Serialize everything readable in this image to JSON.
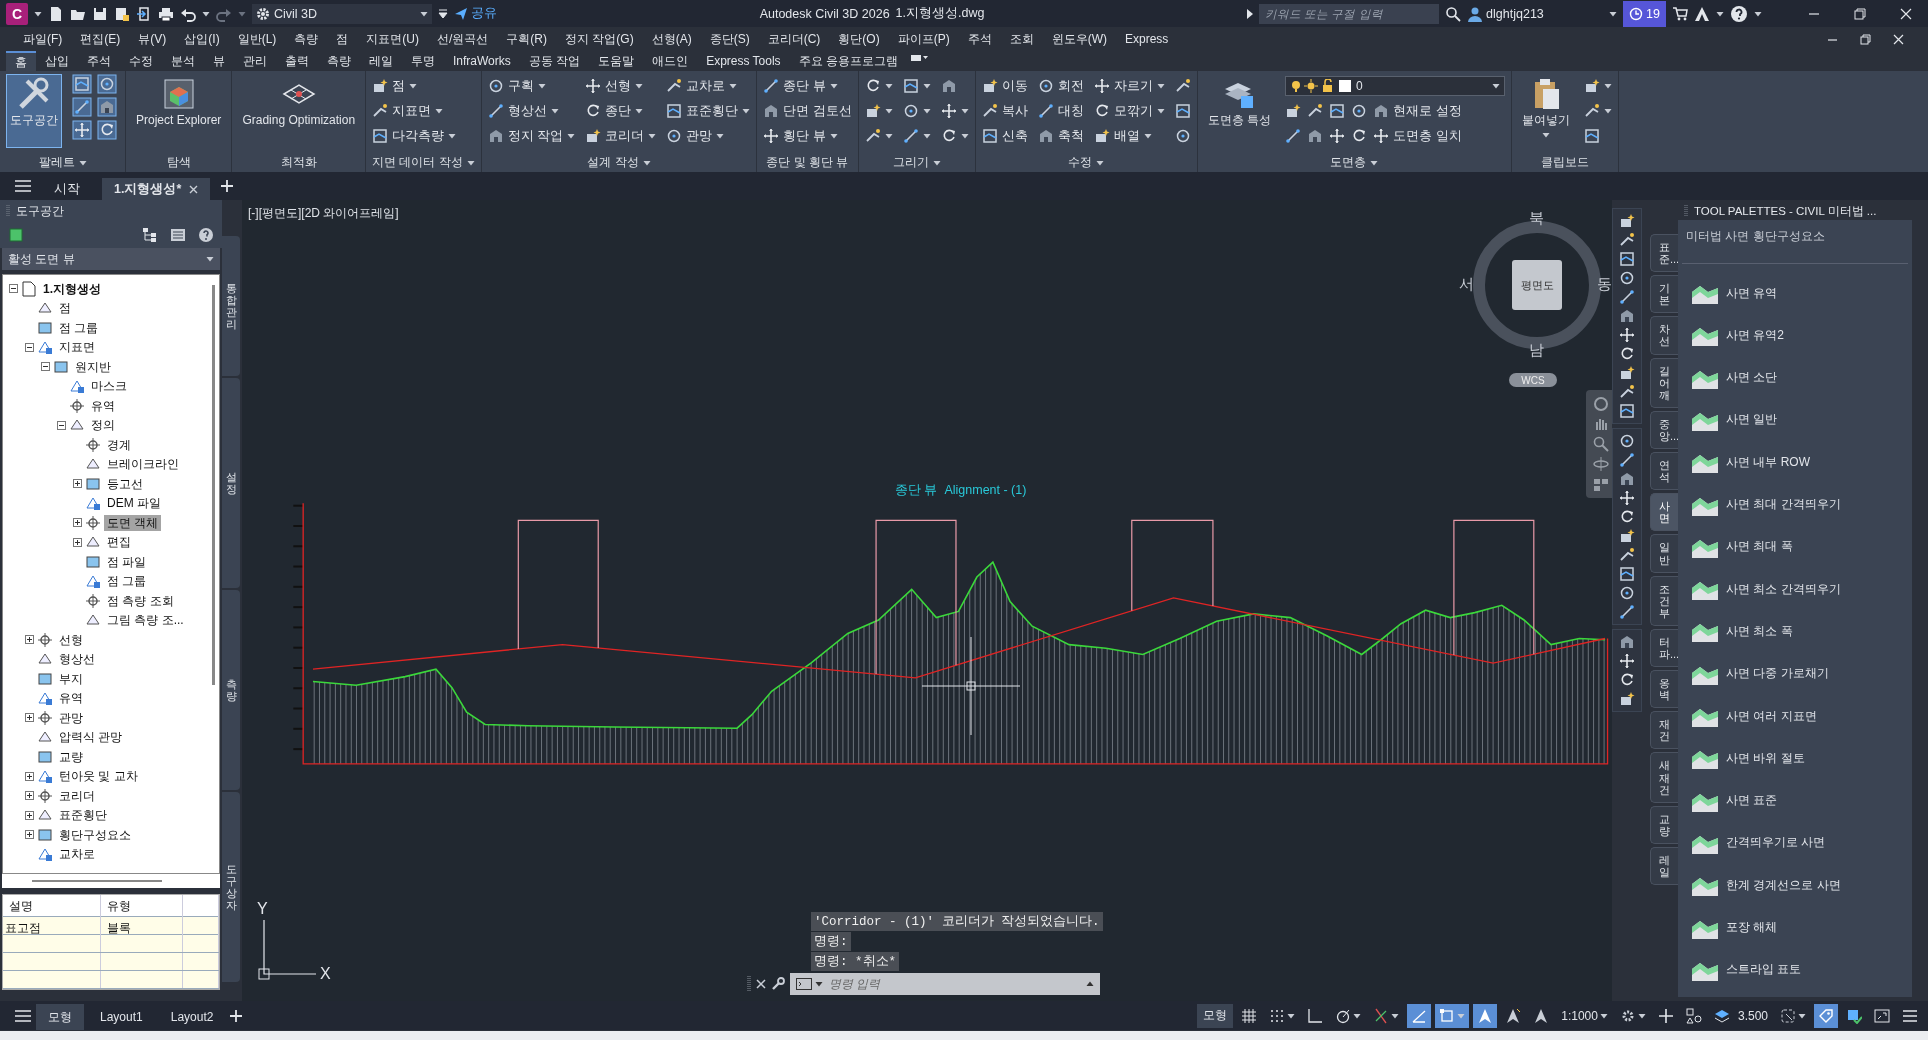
{
  "title_bar": {
    "app_logo": "C",
    "workspace": "Civil 3D",
    "share": "공유",
    "app_name": "Autodesk Civil 3D 2026",
    "file_name": "1.지형생성.dwg",
    "search": {
      "placeholder": "키워드 또는 구절 입력"
    },
    "user": "dlghtjq213",
    "badge": "19"
  },
  "menu_bar": [
    "파일(F)",
    "편집(E)",
    "뷰(V)",
    "삽입(I)",
    "일반(L)",
    "측량",
    "점",
    "지표면(U)",
    "선/원곡선",
    "구획(R)",
    "정지 작업(G)",
    "선형(A)",
    "종단(S)",
    "코리더(C)",
    "횡단(O)",
    "파이프(P)",
    "주석",
    "조회",
    "윈도우(W)",
    "Express"
  ],
  "ribbon_tabs": [
    {
      "label": "홈",
      "selected": true
    },
    {
      "label": "삽입",
      "selected": false
    },
    {
      "label": "주석",
      "selected": false
    },
    {
      "label": "수정",
      "selected": false
    },
    {
      "label": "분석",
      "selected": false
    },
    {
      "label": "뷰",
      "selected": false
    },
    {
      "label": "관리",
      "selected": false
    },
    {
      "label": "출력",
      "selected": false
    },
    {
      "label": "측량",
      "selected": false
    },
    {
      "label": "레일",
      "selected": false
    },
    {
      "label": "투명",
      "selected": false
    },
    {
      "label": "InfraWorks",
      "selected": false
    },
    {
      "label": "공동 작업",
      "selected": false
    },
    {
      "label": "도움말",
      "selected": false
    },
    {
      "label": "애드인",
      "selected": false
    },
    {
      "label": "Express Tools",
      "selected": false
    },
    {
      "label": "주요 응용프로그램",
      "selected": false
    }
  ],
  "ribbon_panels": [
    {
      "title": "팔레트",
      "menu": true,
      "kind": "palettes",
      "big": {
        "label": "도구공간",
        "active": true
      }
    },
    {
      "title": "탐색",
      "menu": false,
      "kind": "big",
      "big": {
        "label": "Project Explorer",
        "active": false
      }
    },
    {
      "title": "최적화",
      "menu": false,
      "kind": "big",
      "big": {
        "label": "Grading Optimization",
        "active": false
      }
    },
    {
      "title": "지면 데이터 작성",
      "menu": true,
      "kind": "columns",
      "columns": [
        [
          {
            "label": "점",
            "dropdown": true
          },
          {
            "label": "지표면",
            "dropdown": true
          },
          {
            "label": "다각측량",
            "dropdown": true
          }
        ]
      ]
    },
    {
      "title": "설계 작성",
      "menu": true,
      "kind": "columns",
      "columns": [
        [
          {
            "label": "구획",
            "dropdown": true
          },
          {
            "label": "형상선",
            "dropdown": true
          },
          {
            "label": "정지 작업",
            "dropdown": true
          }
        ],
        [
          {
            "label": "선형",
            "dropdown": true
          },
          {
            "label": "종단",
            "dropdown": true
          },
          {
            "label": "코리더",
            "dropdown": true
          }
        ],
        [
          {
            "label": "교차로",
            "dropdown": true
          },
          {
            "label": "표준횡단",
            "dropdown": true
          },
          {
            "label": "관망",
            "dropdown": true
          }
        ]
      ]
    },
    {
      "title": "종단 및 횡단 뷰",
      "menu": false,
      "kind": "columns",
      "columns": [
        [
          {
            "label": "종단 뷰",
            "dropdown": true
          },
          {
            "label": "단면 검토선",
            "dropdown": false
          },
          {
            "label": "횡단 뷰",
            "dropdown": true
          }
        ]
      ]
    },
    {
      "title": "그리기",
      "menu": true,
      "kind": "columns",
      "columns": [
        [
          {
            "dropdown": true
          },
          {
            "dropdown": true
          },
          {
            "dropdown": true
          }
        ],
        [
          {
            "dropdown": true
          },
          {
            "dropdown": true
          },
          {
            "dropdown": true
          }
        ],
        [
          {
            "dropdown": false
          },
          {
            "dropdown": true
          },
          {
            "dropdown": true
          }
        ]
      ]
    },
    {
      "title": "수정",
      "menu": true,
      "kind": "columns",
      "columns": [
        [
          {
            "label": "이동",
            "dropdown": false
          },
          {
            "label": "복사",
            "dropdown": false
          },
          {
            "label": "신축",
            "dropdown": false
          }
        ],
        [
          {
            "label": "회전",
            "dropdown": false
          },
          {
            "label": "대칭",
            "dropdown": false
          },
          {
            "label": "축척",
            "dropdown": false
          }
        ],
        [
          {
            "label": "자르기",
            "dropdown": true
          },
          {
            "label": "모깎기",
            "dropdown": true
          },
          {
            "label": "배열",
            "dropdown": true
          }
        ],
        [
          {
            "dropdown": false
          },
          {
            "dropdown": false
          },
          {
            "dropdown": false
          }
        ]
      ]
    },
    {
      "title": "도면층",
      "menu": true,
      "kind": "layers",
      "big": {
        "label": "도면층 특성",
        "active": false
      },
      "layer": "0",
      "actions": [
        "현재로 설정",
        "도면층 일치"
      ]
    },
    {
      "title": "클립보드",
      "menu": false,
      "kind": "clipboard",
      "big": {
        "label": "붙여넣기",
        "active": false
      }
    }
  ],
  "doc_tabs": [
    {
      "label": "시작",
      "selected": false
    },
    {
      "label": "1.지형생성*",
      "selected": true
    }
  ],
  "toolspace": {
    "title": "도구공간",
    "view": "활성 도면 뷰",
    "tree": [
      {
        "label": "1.지형생성",
        "expanded": true,
        "selected": false,
        "children": [
          {
            "label": "점",
            "selected": false
          },
          {
            "label": "점 그룹",
            "selected": false
          },
          {
            "label": "지표면",
            "expanded": true,
            "selected": false,
            "children": [
              {
                "label": "원지반",
                "expanded": true,
                "selected": false,
                "children": [
                  {
                    "label": "마스크",
                    "selected": false
                  },
                  {
                    "label": "유역",
                    "selected": false
                  },
                  {
                    "label": "정의",
                    "expanded": true,
                    "selected": false,
                    "children": [
                      {
                        "label": "경계",
                        "selected": false
                      },
                      {
                        "label": "브레이크라인",
                        "selected": false
                      },
                      {
                        "label": "등고선",
                        "expanded": false,
                        "selected": false
                      },
                      {
                        "label": "DEM 파일",
                        "selected": false
                      },
                      {
                        "label": "도면 객체",
                        "expanded": false,
                        "selected": true
                      },
                      {
                        "label": "편집",
                        "expanded": false,
                        "selected": false
                      },
                      {
                        "label": "점 파일",
                        "selected": false
                      },
                      {
                        "label": "점 그룹",
                        "selected": false
                      },
                      {
                        "label": "점 측량 조회",
                        "selected": false
                      },
                      {
                        "label": "그림 측량 조...",
                        "selected": false
                      }
                    ]
                  }
                ]
              }
            ]
          },
          {
            "label": "선형",
            "expanded": false,
            "selected": false
          },
          {
            "label": "형상선",
            "selected": false
          },
          {
            "label": "부지",
            "selected": false
          },
          {
            "label": "유역",
            "selected": false
          },
          {
            "label": "관망",
            "expanded": false,
            "selected": false
          },
          {
            "label": "압력식 관망",
            "selected": false
          },
          {
            "label": "교량",
            "selected": false
          },
          {
            "label": "턴아웃 및 교차",
            "expanded": false,
            "selected": false
          },
          {
            "label": "코리더",
            "expanded": false,
            "selected": false
          },
          {
            "label": "표준횡단",
            "expanded": false,
            "selected": false
          },
          {
            "label": "횡단구성요소",
            "expanded": false,
            "selected": false
          },
          {
            "label": "교차로",
            "selected": false
          }
        ]
      }
    ],
    "side_tabs": [
      "통합관리",
      "설정",
      "측량",
      "도구 상자"
    ],
    "table": {
      "columns": [
        "설명",
        "유형"
      ],
      "rows": [
        [
          "표고점",
          "블록"
        ]
      ]
    }
  },
  "canvas": {
    "viewport_label": "[-][평면도][2D 와이어프레임]",
    "viewcube": {
      "north": "북",
      "south": "남",
      "east": "동",
      "west": "서",
      "face": "평면도",
      "ucs": "WCS"
    },
    "profile_title": "종단 뷰  Alignment - (1)",
    "ucs_axes": {
      "y": "Y",
      "x": "X"
    },
    "command_history": [
      "'Corridor - (1)' 코리더가 작성되었습니다.",
      "명령:",
      "명령: *취소*"
    ],
    "command_input": {
      "placeholder": "명령 입력"
    }
  },
  "tool_palette": {
    "title": "TOOL PALETTES - CIVIL 미터법 ...",
    "subtitle": "미터법 사면 횡단구성요소",
    "tabs": [
      {
        "label": "표준...",
        "selected": false
      },
      {
        "label": "기본",
        "selected": false
      },
      {
        "label": "차선",
        "selected": false
      },
      {
        "label": "길어깨",
        "selected": false
      },
      {
        "label": "중앙...",
        "selected": false
      },
      {
        "label": "연석",
        "selected": false
      },
      {
        "label": "사면",
        "selected": true
      },
      {
        "label": "일반",
        "selected": false
      },
      {
        "label": "조건부",
        "selected": false
      },
      {
        "label": "터파...",
        "selected": false
      },
      {
        "label": "옹벽",
        "selected": false
      },
      {
        "label": "재건",
        "selected": false
      },
      {
        "label": "새 재건",
        "selected": false
      },
      {
        "label": "교량",
        "selected": false
      },
      {
        "label": "레일",
        "selected": false
      }
    ],
    "items": [
      "사면 유역",
      "사면 유역2",
      "사면 소단",
      "사면 일반",
      "사면 내부 ROW",
      "사면 최대 간격띄우기",
      "사면 최대 폭",
      "사면 최소 간격띄우기",
      "사면 최소 폭",
      "사면 다중 가로채기",
      "사면 여러 지표면",
      "사면 바위 절토",
      "사면 표준",
      "간격띄우기로 사면",
      "한계 경계선으로 사면",
      "포장 해체",
      "스트라입 표토"
    ]
  },
  "status_bar": {
    "layout_tabs": [
      {
        "label": "모형",
        "selected": true
      },
      {
        "label": "Layout1",
        "selected": false
      },
      {
        "label": "Layout2",
        "selected": false
      }
    ],
    "items": [
      {
        "kind": "label",
        "text": "모형"
      },
      {
        "kind": "toggle",
        "on": false,
        "menu": false
      },
      {
        "kind": "toggle",
        "on": false,
        "menu": true
      },
      {
        "kind": "toggle",
        "on": false,
        "menu": false
      },
      {
        "kind": "toggle",
        "on": false,
        "menu": true
      },
      {
        "kind": "toggle",
        "on": false,
        "menu": true
      },
      {
        "kind": "toggle",
        "on": true,
        "menu": false
      },
      {
        "kind": "toggle",
        "on": true,
        "menu": true
      },
      {
        "kind": "toggle",
        "on": true,
        "menu": false
      },
      {
        "kind": "toggle",
        "on": false,
        "menu": false
      },
      {
        "kind": "toggle",
        "on": false,
        "menu": false
      },
      {
        "kind": "dropdown",
        "text": "1:1000"
      },
      {
        "kind": "toggle",
        "on": false,
        "menu": true
      },
      {
        "kind": "toggle",
        "on": false,
        "menu": false
      },
      {
        "kind": "toggle",
        "on": false,
        "menu": false
      },
      {
        "kind": "value",
        "text": "3.500"
      },
      {
        "kind": "toggle",
        "on": false,
        "menu": true
      },
      {
        "kind": "toggle",
        "on": true,
        "menu": false
      },
      {
        "kind": "toggle",
        "on": false,
        "menu": false
      },
      {
        "kind": "toggle",
        "on": false,
        "menu": false
      },
      {
        "kind": "toggle",
        "on": false,
        "menu": false
      }
    ]
  }
}
